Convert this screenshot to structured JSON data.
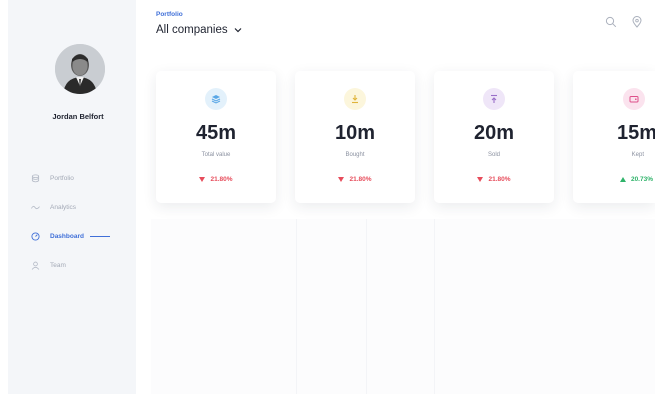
{
  "user": {
    "name": "Jordan Belfort"
  },
  "nav": [
    {
      "label": "Portfolio",
      "icon": "database-icon",
      "active": false
    },
    {
      "label": "Analytics",
      "icon": "wave-icon",
      "active": false
    },
    {
      "label": "Dashboard",
      "icon": "gauge-icon",
      "active": true
    },
    {
      "label": "Team",
      "icon": "user-icon",
      "active": false
    }
  ],
  "header": {
    "section": "Portfolio",
    "title": "All companies"
  },
  "icons": {
    "search": "search-icon",
    "location": "location-pin-icon"
  },
  "cards": [
    {
      "value": "45m",
      "label": "Total value",
      "change": "21.80%",
      "direction": "down",
      "icon": "layers-icon",
      "icon_color": "#5aa7e6",
      "icon_bg": "#e3f1fb"
    },
    {
      "value": "10m",
      "label": "Bought",
      "change": "21.80%",
      "direction": "down",
      "icon": "arrow-down-tray-icon",
      "icon_color": "#e0b43a",
      "icon_bg": "#fcf6dc"
    },
    {
      "value": "20m",
      "label": "Sold",
      "change": "21.80%",
      "direction": "down",
      "icon": "arrow-up-tray-icon",
      "icon_color": "#9a6fc9",
      "icon_bg": "#efe6f8"
    },
    {
      "value": "15m",
      "label": "Kept",
      "change": "20.73%",
      "direction": "up",
      "icon": "wallet-icon",
      "icon_color": "#de4f8a",
      "icon_bg": "#fbe3ee"
    }
  ],
  "colors": {
    "accent": "#3f6fd8",
    "negative": "#e74c5b",
    "positive": "#2fb36a"
  }
}
